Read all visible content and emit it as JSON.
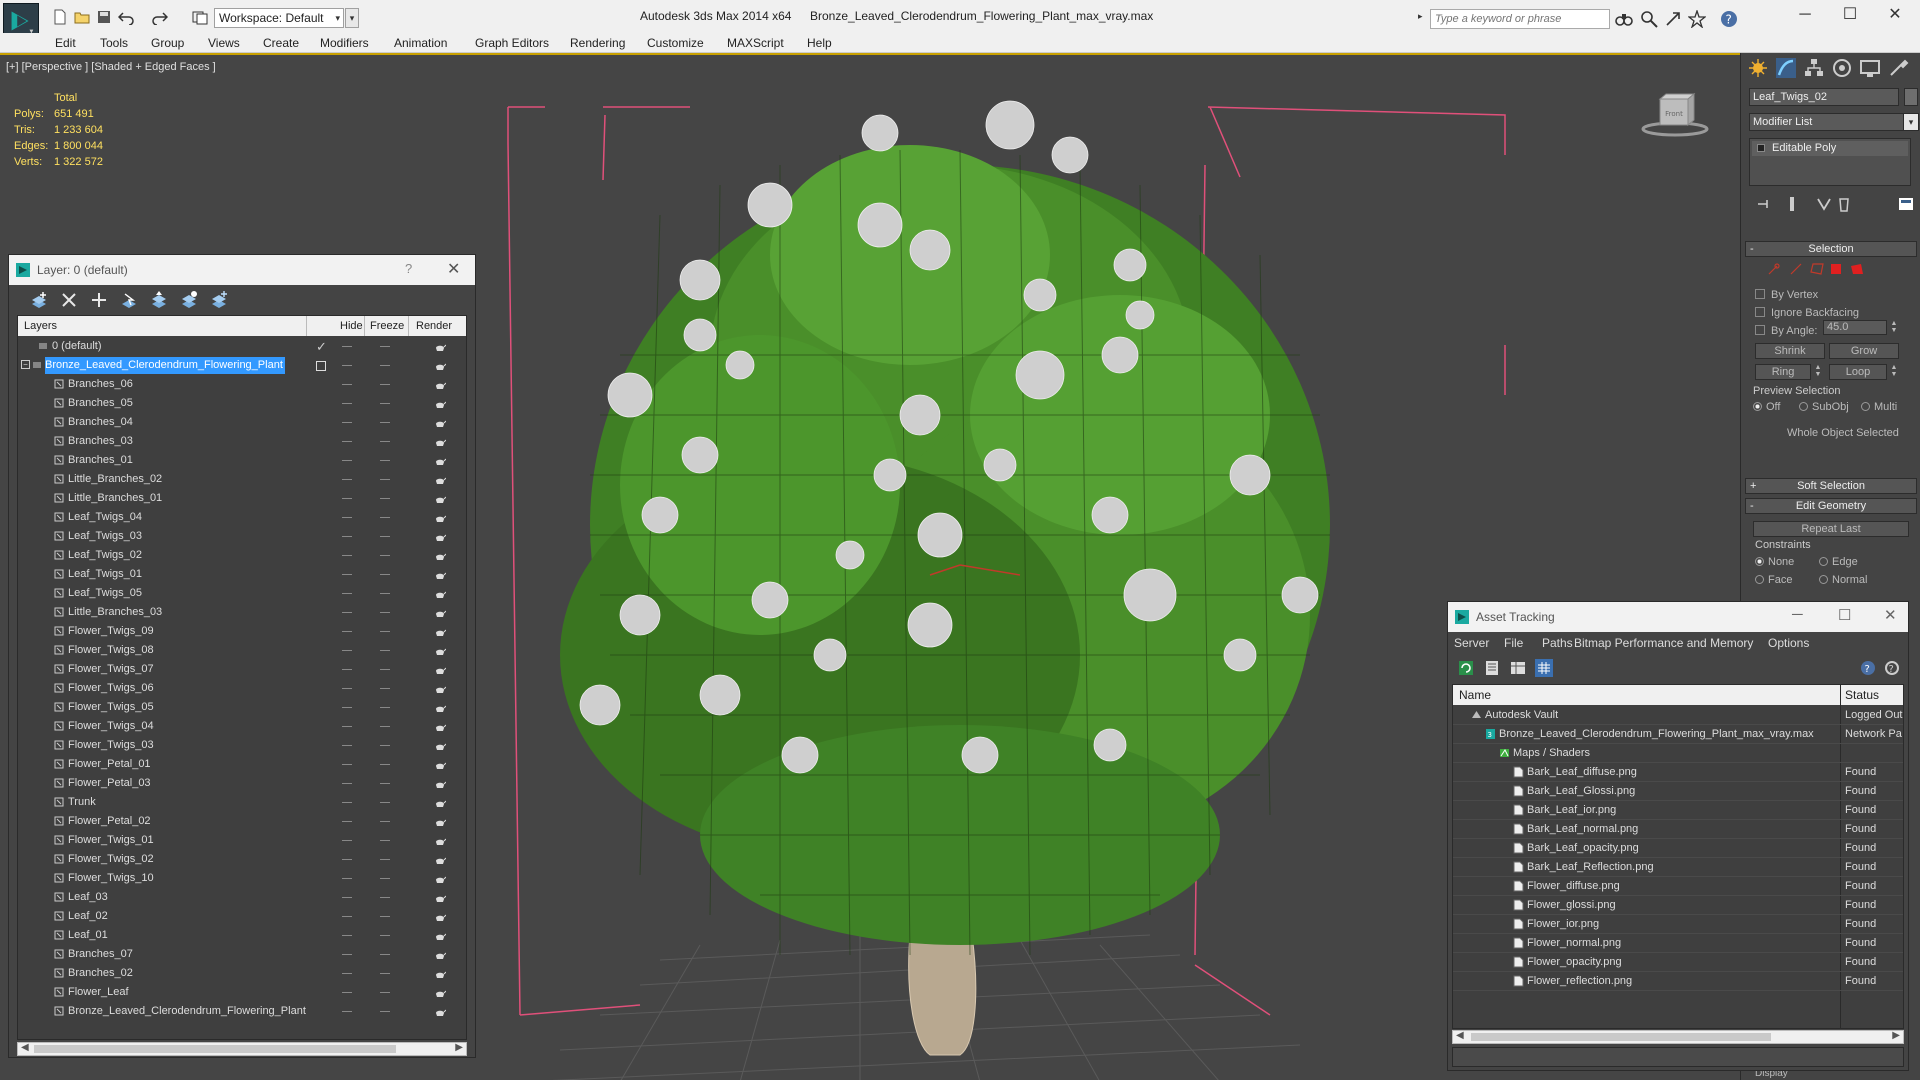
{
  "title_bar": {
    "app_title": "Autodesk 3ds Max  2014 x64",
    "file_title": "Bronze_Leaved_Clerodendrum_Flowering_Plant_max_vray.max",
    "workspace": "Workspace: Default",
    "search_placeholder": "Type a keyword or phrase"
  },
  "menu": [
    "Edit",
    "Tools",
    "Group",
    "Views",
    "Create",
    "Modifiers",
    "Animation",
    "Graph Editors",
    "Rendering",
    "Customize",
    "MAXScript",
    "Help"
  ],
  "viewport": {
    "label": "[+] [Perspective ] [Shaded + Edged Faces ]",
    "stats": {
      "header": "Total",
      "rows": [
        {
          "k": "Polys:",
          "v": "651 491"
        },
        {
          "k": "Tris:",
          "v": "1 233 604"
        },
        {
          "k": "Edges:",
          "v": "1 800 044"
        },
        {
          "k": "Verts:",
          "v": "1 322 572"
        }
      ]
    },
    "viewcube_label": "Front"
  },
  "layer_panel": {
    "title": "Layer: 0 (default)",
    "help": "?",
    "columns": {
      "layers": "Layers",
      "hide": "Hide",
      "freeze": "Freeze",
      "render": "Render"
    },
    "rows": [
      {
        "name": "0 (default)",
        "indent": 1,
        "type": "layer",
        "mark": "check"
      },
      {
        "name": "Bronze_Leaved_Clerodendrum_Flowering_Plant",
        "indent": 0,
        "type": "layer",
        "selected": true,
        "mark": "box"
      },
      {
        "name": "Branches_06",
        "indent": 2,
        "type": "obj"
      },
      {
        "name": "Branches_05",
        "indent": 2,
        "type": "obj"
      },
      {
        "name": "Branches_04",
        "indent": 2,
        "type": "obj"
      },
      {
        "name": "Branches_03",
        "indent": 2,
        "type": "obj"
      },
      {
        "name": "Branches_01",
        "indent": 2,
        "type": "obj"
      },
      {
        "name": "Little_Branches_02",
        "indent": 2,
        "type": "obj"
      },
      {
        "name": "Little_Branches_01",
        "indent": 2,
        "type": "obj"
      },
      {
        "name": "Leaf_Twigs_04",
        "indent": 2,
        "type": "obj"
      },
      {
        "name": "Leaf_Twigs_03",
        "indent": 2,
        "type": "obj"
      },
      {
        "name": "Leaf_Twigs_02",
        "indent": 2,
        "type": "obj"
      },
      {
        "name": "Leaf_Twigs_01",
        "indent": 2,
        "type": "obj"
      },
      {
        "name": "Leaf_Twigs_05",
        "indent": 2,
        "type": "obj"
      },
      {
        "name": "Little_Branches_03",
        "indent": 2,
        "type": "obj"
      },
      {
        "name": "Flower_Twigs_09",
        "indent": 2,
        "type": "obj"
      },
      {
        "name": "Flower_Twigs_08",
        "indent": 2,
        "type": "obj"
      },
      {
        "name": "Flower_Twigs_07",
        "indent": 2,
        "type": "obj"
      },
      {
        "name": "Flower_Twigs_06",
        "indent": 2,
        "type": "obj"
      },
      {
        "name": "Flower_Twigs_05",
        "indent": 2,
        "type": "obj"
      },
      {
        "name": "Flower_Twigs_04",
        "indent": 2,
        "type": "obj"
      },
      {
        "name": "Flower_Twigs_03",
        "indent": 2,
        "type": "obj"
      },
      {
        "name": "Flower_Petal_01",
        "indent": 2,
        "type": "obj"
      },
      {
        "name": "Flower_Petal_03",
        "indent": 2,
        "type": "obj"
      },
      {
        "name": "Trunk",
        "indent": 2,
        "type": "obj"
      },
      {
        "name": "Flower_Petal_02",
        "indent": 2,
        "type": "obj"
      },
      {
        "name": "Flower_Twigs_01",
        "indent": 2,
        "type": "obj"
      },
      {
        "name": "Flower_Twigs_02",
        "indent": 2,
        "type": "obj"
      },
      {
        "name": "Flower_Twigs_10",
        "indent": 2,
        "type": "obj"
      },
      {
        "name": "Leaf_03",
        "indent": 2,
        "type": "obj"
      },
      {
        "name": "Leaf_02",
        "indent": 2,
        "type": "obj"
      },
      {
        "name": "Leaf_01",
        "indent": 2,
        "type": "obj"
      },
      {
        "name": "Branches_07",
        "indent": 2,
        "type": "obj"
      },
      {
        "name": "Branches_02",
        "indent": 2,
        "type": "obj"
      },
      {
        "name": "Flower_Leaf",
        "indent": 2,
        "type": "obj"
      },
      {
        "name": "Bronze_Leaved_Clerodendrum_Flowering_Plant",
        "indent": 2,
        "type": "obj"
      }
    ]
  },
  "command_panel": {
    "object_name": "Leaf_Twigs_02",
    "modifier_list": "Modifier List",
    "stack_item": "Editable Poly",
    "selection": {
      "title": "Selection",
      "by_vertex": "By Vertex",
      "ignore_backfacing": "Ignore Backfacing",
      "by_angle": "By Angle:",
      "angle_value": "45.0",
      "shrink": "Shrink",
      "grow": "Grow",
      "ring": "Ring",
      "loop": "Loop",
      "preview_title": "Preview Selection",
      "preview_off": "Off",
      "preview_subobj": "SubObj",
      "preview_multi": "Multi",
      "status": "Whole Object Selected"
    },
    "soft_selection": "Soft Selection",
    "edit_geometry": "Edit Geometry",
    "repeat_last": "Repeat Last",
    "constraints_title": "Constraints",
    "constraints": {
      "none": "None",
      "edge": "Edge",
      "face": "Face",
      "normal": "Normal"
    },
    "display": "Display",
    "pm_plus": "+",
    "pm_minus": "-"
  },
  "asset_panel": {
    "title": "Asset Tracking",
    "menu": [
      "Server",
      "File",
      "Paths",
      "Bitmap Performance and Memory",
      "Options"
    ],
    "columns": {
      "name": "Name",
      "status": "Status"
    },
    "rows": [
      {
        "name": "Autodesk Vault",
        "status": "Logged Out",
        "indent": 1,
        "icon": "vault"
      },
      {
        "name": "Bronze_Leaved_Clerodendrum_Flowering_Plant_max_vray.max",
        "status": "Network Pa",
        "indent": 2,
        "icon": "max"
      },
      {
        "name": "Maps / Shaders",
        "status": "",
        "indent": 3,
        "icon": "maps"
      },
      {
        "name": "Bark_Leaf_diffuse.png",
        "status": "Found",
        "indent": 4,
        "icon": "file"
      },
      {
        "name": "Bark_Leaf_Glossi.png",
        "status": "Found",
        "indent": 4,
        "icon": "file"
      },
      {
        "name": "Bark_Leaf_ior.png",
        "status": "Found",
        "indent": 4,
        "icon": "file"
      },
      {
        "name": "Bark_Leaf_normal.png",
        "status": "Found",
        "indent": 4,
        "icon": "file"
      },
      {
        "name": "Bark_Leaf_opacity.png",
        "status": "Found",
        "indent": 4,
        "icon": "file"
      },
      {
        "name": "Bark_Leaf_Reflection.png",
        "status": "Found",
        "indent": 4,
        "icon": "file"
      },
      {
        "name": "Flower_diffuse.png",
        "status": "Found",
        "indent": 4,
        "icon": "file"
      },
      {
        "name": "Flower_glossi.png",
        "status": "Found",
        "indent": 4,
        "icon": "file"
      },
      {
        "name": "Flower_ior.png",
        "status": "Found",
        "indent": 4,
        "icon": "file"
      },
      {
        "name": "Flower_normal.png",
        "status": "Found",
        "indent": 4,
        "icon": "file"
      },
      {
        "name": "Flower_opacity.png",
        "status": "Found",
        "indent": 4,
        "icon": "file"
      },
      {
        "name": "Flower_reflection.png",
        "status": "Found",
        "indent": 4,
        "icon": "file"
      }
    ]
  },
  "colors": {
    "viewport_bg": "#454545",
    "stats_text": "#ffe060",
    "selection_highlight": "#3399ff",
    "leaf_green": "#4f9a2a",
    "bounding_box": "#e0507a"
  }
}
